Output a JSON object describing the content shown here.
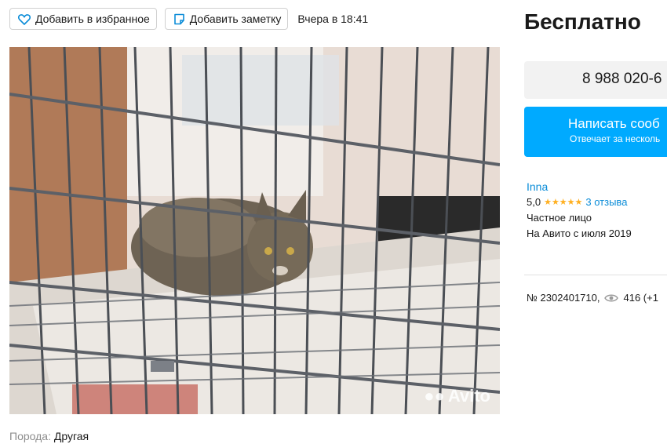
{
  "toolbar": {
    "favorite_label": "Добавить в избранное",
    "note_label": "Добавить заметку",
    "timestamp": "Вчера в 18:41"
  },
  "photo": {
    "watermark": "Avito",
    "icon": "cat-in-cage-photo"
  },
  "details": {
    "breed_label": "Порода:",
    "breed_value": "Другая"
  },
  "sidebar": {
    "price": "Бесплатно",
    "phone": "8 988 020-6",
    "message_button": {
      "title": "Написать сооб",
      "subtitle": "Отвечает за несколь"
    },
    "seller": {
      "name": "Inna",
      "rating": "5,0",
      "stars": "★★★★★",
      "reviews": "3 отзыва",
      "type": "Частное лицо",
      "since": "На Авито с июля 2019"
    },
    "listing": {
      "number": "№ 2302401710,",
      "views": "416 (+1"
    }
  },
  "colors": {
    "accent": "#00aaff",
    "link": "#0a8cd8",
    "star": "#ffb021"
  }
}
